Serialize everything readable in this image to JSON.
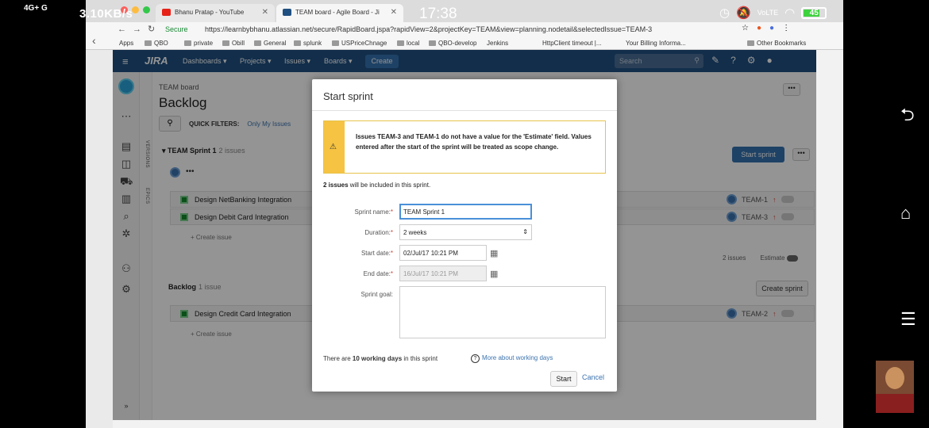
{
  "status_bar": {
    "signal": "4G+ G",
    "speed": "3.10KB/s",
    "time": "17:38",
    "battery": "45"
  },
  "browser": {
    "tabs": [
      {
        "label": "Bhanu Pratap - YouTube",
        "icon_color": "#e62117"
      },
      {
        "label": "TEAM board - Agile Board - Ji",
        "icon_color": "#205081"
      }
    ],
    "secure_label": "Secure",
    "url": "https://learnbybhanu.atlassian.net/secure/RapidBoard.jspa?rapidView=2&projectKey=TEAM&view=planning.nodetail&selectedIssue=TEAM-3",
    "bookmarks": [
      "Apps",
      "QBO",
      "private",
      "Obill",
      "General",
      "splunk",
      "USPriceChnage",
      "local",
      "QBO-develop",
      "Jenkins",
      "HttpClient timeout |...",
      "Your Billing Informa...",
      "Other Bookmarks"
    ]
  },
  "jira_nav": {
    "logo": "JIRA",
    "items": [
      "Dashboards",
      "Projects",
      "Issues",
      "Boards"
    ],
    "create": "Create",
    "search_placeholder": "Search"
  },
  "board": {
    "breadcrumb": "TEAM board",
    "title": "Backlog",
    "quick_filters_label": "QUICK FILTERS:",
    "quick_filter_option": "Only My Issues",
    "vertical_labels": [
      "VERSIONS",
      "EPICS"
    ],
    "sprint": {
      "name": "TEAM Sprint 1",
      "count": "2 issues",
      "start_button": "Start sprint",
      "issues": [
        {
          "summary": "Design NetBanking Integration",
          "key": "TEAM-1"
        },
        {
          "summary": "Design Debit Card Integration",
          "key": "TEAM-3"
        }
      ],
      "create_issue": "+ Create issue",
      "footer_count": "2 issues",
      "footer_estimate": "Estimate"
    },
    "backlog": {
      "name": "Backlog",
      "count": "1 issue",
      "create_sprint": "Create sprint",
      "issues": [
        {
          "summary": "Design Credit Card Integration",
          "key": "TEAM-2"
        }
      ],
      "create_issue": "+ Create issue"
    }
  },
  "modal": {
    "title": "Start sprint",
    "warning": "Issues TEAM-3 and TEAM-1 do not have a value for the 'Estimate' field. Values entered after the start of the sprint will be treated as scope change.",
    "info_count": "2 issues",
    "info_rest": " will be included in this sprint.",
    "fields": {
      "sprint_name_label": "Sprint name:",
      "sprint_name_value": "TEAM Sprint 1",
      "duration_label": "Duration:",
      "duration_value": "2 weeks",
      "start_date_label": "Start date:",
      "start_date_value": "02/Jul/17 10:21 PM",
      "end_date_label": "End date:",
      "end_date_value": "16/Jul/17 10:21 PM",
      "goal_label": "Sprint goal:"
    },
    "footer_pre": "There are ",
    "footer_days": "10 working days",
    "footer_post": " in this sprint",
    "more_link": "More about working days",
    "start_button": "Start",
    "cancel_link": "Cancel"
  }
}
